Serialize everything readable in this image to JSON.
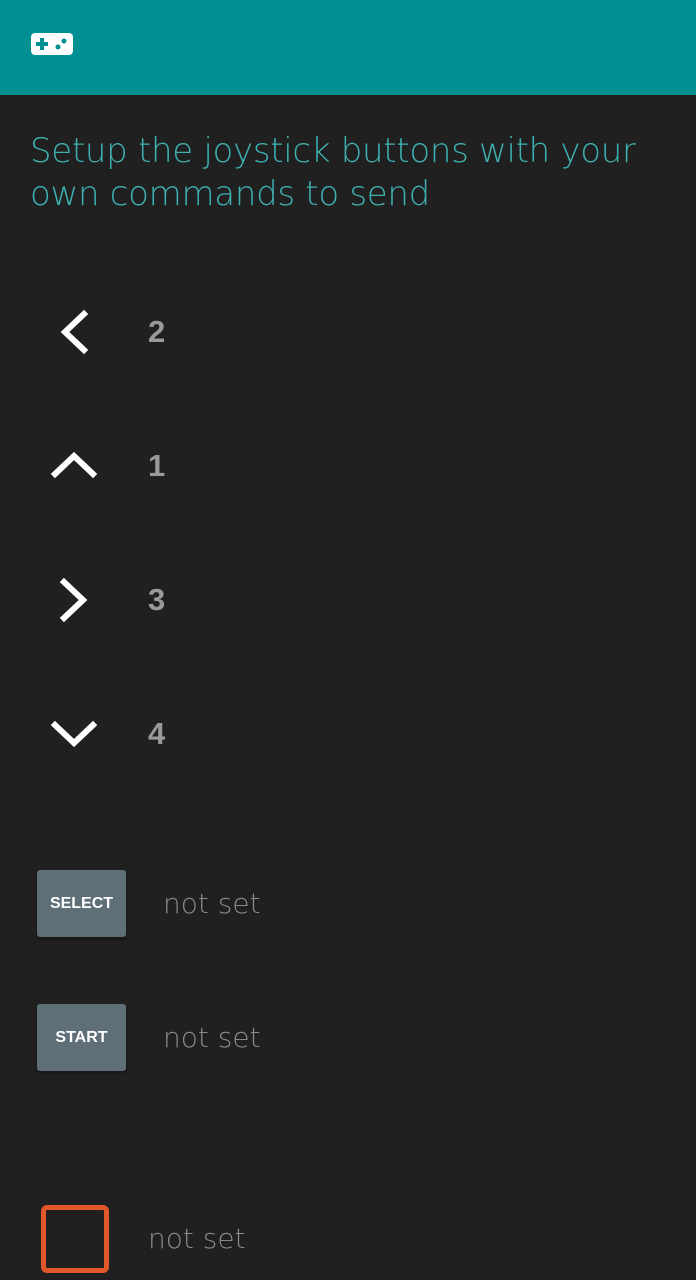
{
  "app_bar": {
    "icon": "gamepad-icon",
    "color": "#009092"
  },
  "heading": "Setup the joystick buttons with your own commands to send",
  "directions": [
    {
      "name": "left",
      "icon": "chevron-left-icon",
      "value": "2"
    },
    {
      "name": "up",
      "icon": "chevron-up-icon",
      "value": "1"
    },
    {
      "name": "right",
      "icon": "chevron-right-icon",
      "value": "3"
    },
    {
      "name": "down",
      "icon": "chevron-down-icon",
      "value": "4"
    }
  ],
  "select": {
    "label": "SELECT",
    "value": "not set"
  },
  "start": {
    "label": "START",
    "value": "not set"
  },
  "square": {
    "icon": "square-icon",
    "value": "not set",
    "color": "#e2572a"
  }
}
